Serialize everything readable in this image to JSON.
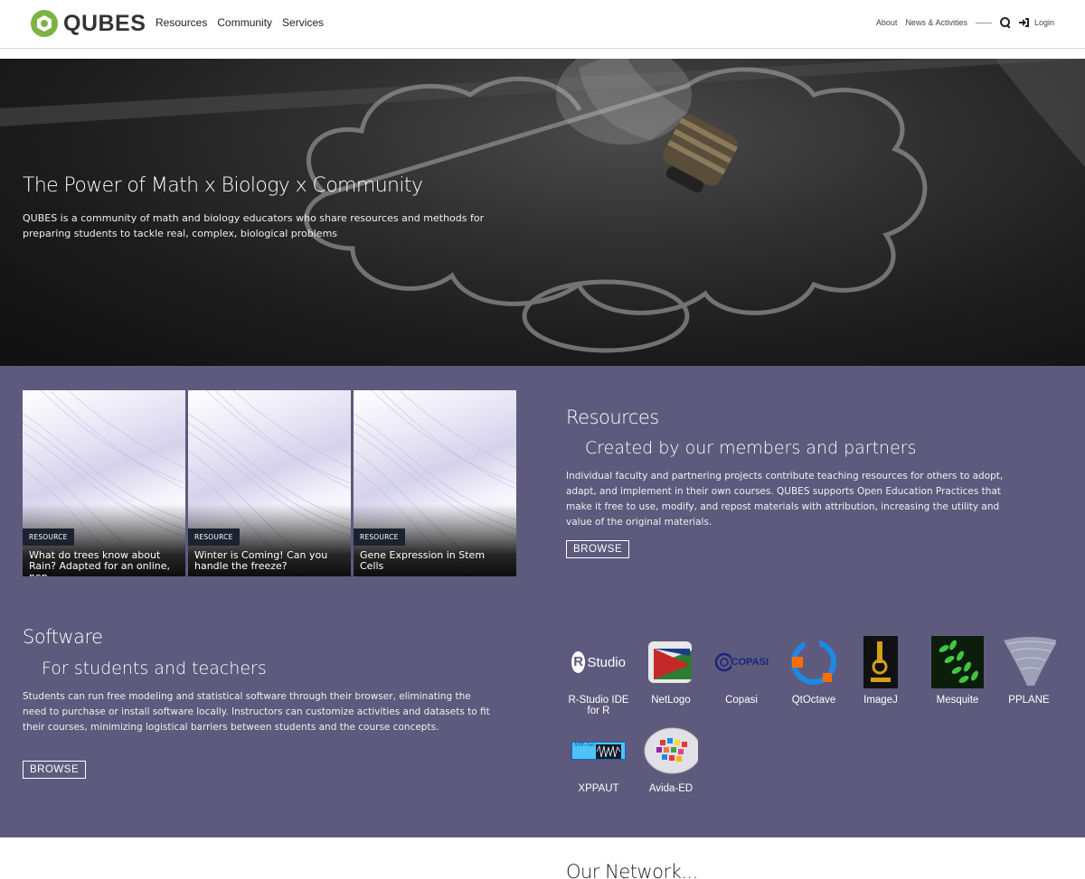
{
  "header": {
    "logo_text": "QUBES",
    "nav": [
      "Resources",
      "Community",
      "Services"
    ],
    "util": {
      "about": "About",
      "news": "News & Activities",
      "login": "Login"
    }
  },
  "hero": {
    "title": "The Power of Math x Biology x Community",
    "description": "QUBES is a community of math and biology educators who share resources and methods for preparing students to tackle real, complex, biological problems"
  },
  "resources": {
    "cards": [
      {
        "badge": "RESOURCE",
        "title": "What do trees know about Rain? Adapted for an online, non-..."
      },
      {
        "badge": "RESOURCE",
        "title": "Winter is Coming! Can you handle the freeze?"
      },
      {
        "badge": "RESOURCE",
        "title": "Gene Expression in Stem Cells"
      }
    ],
    "title": "Resources",
    "subtitle": "Created by our members and partners",
    "description": "Individual faculty and partnering projects contribute teaching resources for others to adopt, adapt, and implement in their own courses. QUBES supports Open Education Practices that make it free to use, modify, and repost materials with attribution, increasing the utility and value of the original materials.",
    "browse": "BROWSE"
  },
  "software": {
    "title": "Software",
    "subtitle": "For students and teachers",
    "description": "Students can run free modeling and statistical software through their browser, eliminating the need to purchase or install software locally. Instructors can customize activities and datasets to fit their courses, minimizing logistical barriers between students and the course concepts.",
    "browse": "BROWSE",
    "tools": [
      {
        "name": "R-Studio IDE for R",
        "icon": "rstudio-icon",
        "icon_text": "Studio"
      },
      {
        "name": "NetLogo",
        "icon": "netlogo-icon"
      },
      {
        "name": "Copasi",
        "icon": "copasi-icon",
        "icon_text": "COPASI"
      },
      {
        "name": "QtOctave",
        "icon": "qtoctave-icon"
      },
      {
        "name": "ImageJ",
        "icon": "imagej-icon"
      },
      {
        "name": "Mesquite",
        "icon": "mesquite-icon"
      },
      {
        "name": "PPLANE",
        "icon": "pplane-icon"
      },
      {
        "name": "XPPAUT",
        "icon": "xppaut-icon",
        "icon_text": "XPP-Aut"
      },
      {
        "name": "Avida-ED",
        "icon": "avida-icon"
      }
    ]
  },
  "network": {
    "title": "Our Network..."
  },
  "colors": {
    "purple": "#5d5a7d",
    "logo_green": "#7cb342",
    "badge": "#1d2230"
  }
}
